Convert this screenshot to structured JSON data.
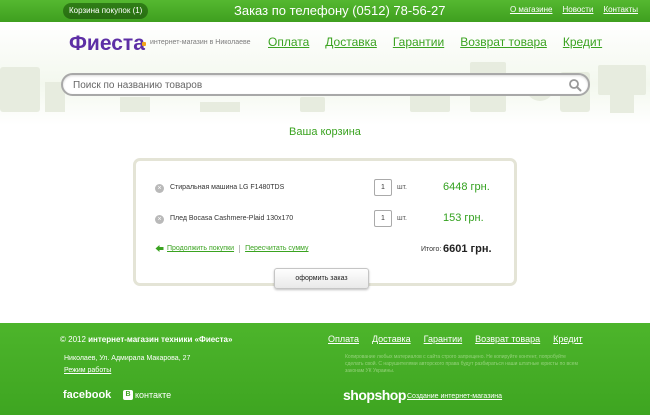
{
  "topbar": {
    "cart_label": "Корзина покупок (1)",
    "phone": "Заказ по телефону (0512) 78-56-27",
    "links": [
      "О магазине",
      "Новости",
      "Контакты"
    ]
  },
  "header": {
    "logo": "Фиеста",
    "tagline": "интернет-магазин в Николаеве",
    "nav": [
      "Оплата",
      "Доставка",
      "Гарантии",
      "Возврат товара",
      "Кредит"
    ]
  },
  "search": {
    "placeholder": "Поиск по названию товаров"
  },
  "cart": {
    "title": "Ваша корзина",
    "items": [
      {
        "name": "Стиральная машина LG F1480TDS",
        "qty": "1",
        "unit": "шт.",
        "price": "6448 грн."
      },
      {
        "name": "Плед Bocasa Cashmere-Plaid 130x170",
        "qty": "1",
        "unit": "шт.",
        "price": "153 грн."
      }
    ],
    "continue_label": "Продолжить покупки",
    "recalc_label": "Пересчитать сумму",
    "total_label": "Итого:",
    "total_value": "6601 грн.",
    "checkout_label": "оформить заказ"
  },
  "footer": {
    "copyright_prefix": "© 2012 ",
    "copyright_bold": "интернет-магазин техники «Фиеста»",
    "nav": [
      "Оплата",
      "Доставка",
      "Гарантии",
      "Возврат товара",
      "Кредит"
    ],
    "address": "Николаев, Ул. Адмирала Макарова, 27",
    "hours_label": "Режим работы",
    "legal": "Копирование любых материалов с сайта строго запрещено. Не копируйте контент, попробуйте сделать свой. С нарушителями авторского права будут разбираться наши штатные юристы по всем законам УК Украины.",
    "facebook_label": "facebook",
    "vk_label": "контакте",
    "vk_mark": "B",
    "shopshop_label": "shopshop",
    "developer_link": "Создание интернет-магазина"
  },
  "colors": {
    "green": "#3aa320",
    "topbar": "#4aad27",
    "logo_purple": "#5d2fa5",
    "footer_green": "#45ad26"
  }
}
